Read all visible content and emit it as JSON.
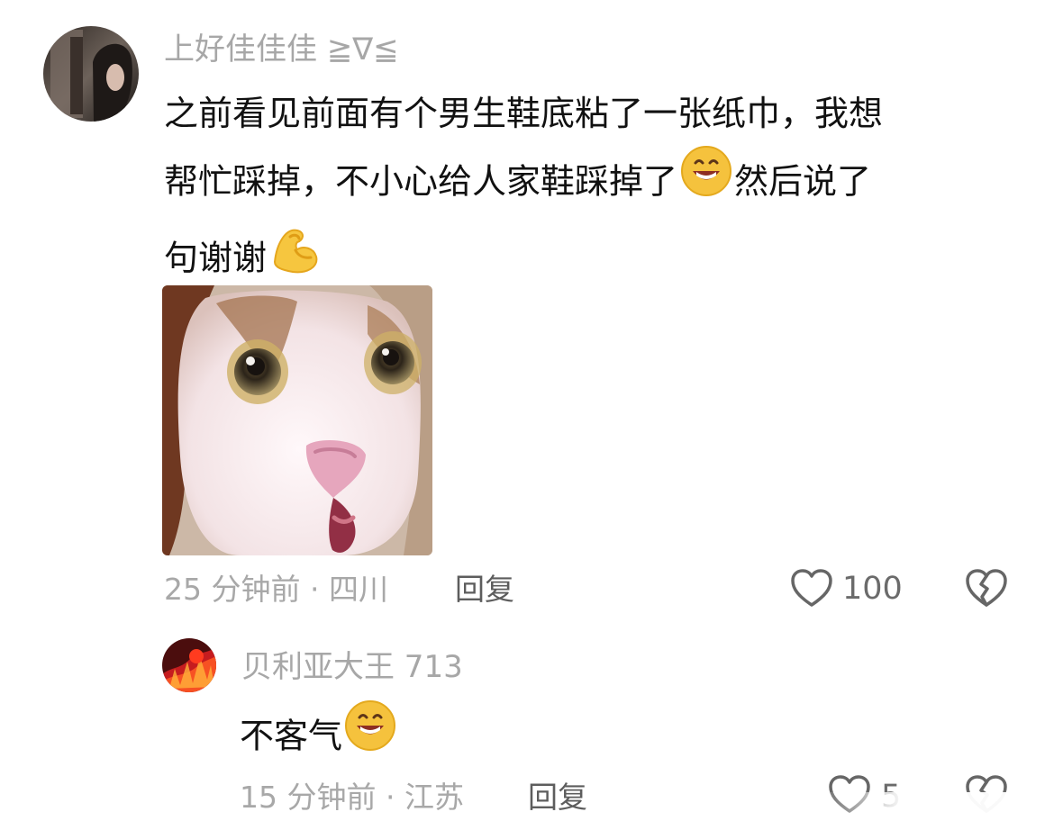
{
  "comments": [
    {
      "username": "上好佳佳佳 ≧∇≦",
      "text_line1": "之前看见前面有个男生鞋底粘了一张纸巾，我想",
      "text_line2a": "帮忙踩掉，不小心给人家鞋踩掉了",
      "text_line2b": "然后说了",
      "text_line3": "句谢谢",
      "emoji_1": "grin-emoji",
      "emoji_2": "flexed-biceps-emoji",
      "image": "shocked-cat-image",
      "time": "25 分钟前 · 四川",
      "reply_label": "回复",
      "likes": "100"
    },
    {
      "username": "贝利亚大王 713",
      "text": "不客气",
      "emoji": "grin-emoji",
      "time": "15 分钟前 · 江苏",
      "reply_label": "回复",
      "likes": "5"
    }
  ],
  "icons": {
    "like": "heart-outline-icon",
    "dislike": "broken-heart-icon"
  },
  "colors": {
    "text": "#111111",
    "meta": "#a8a8a8",
    "username": "#a7a7a7",
    "icon": "#666666"
  }
}
